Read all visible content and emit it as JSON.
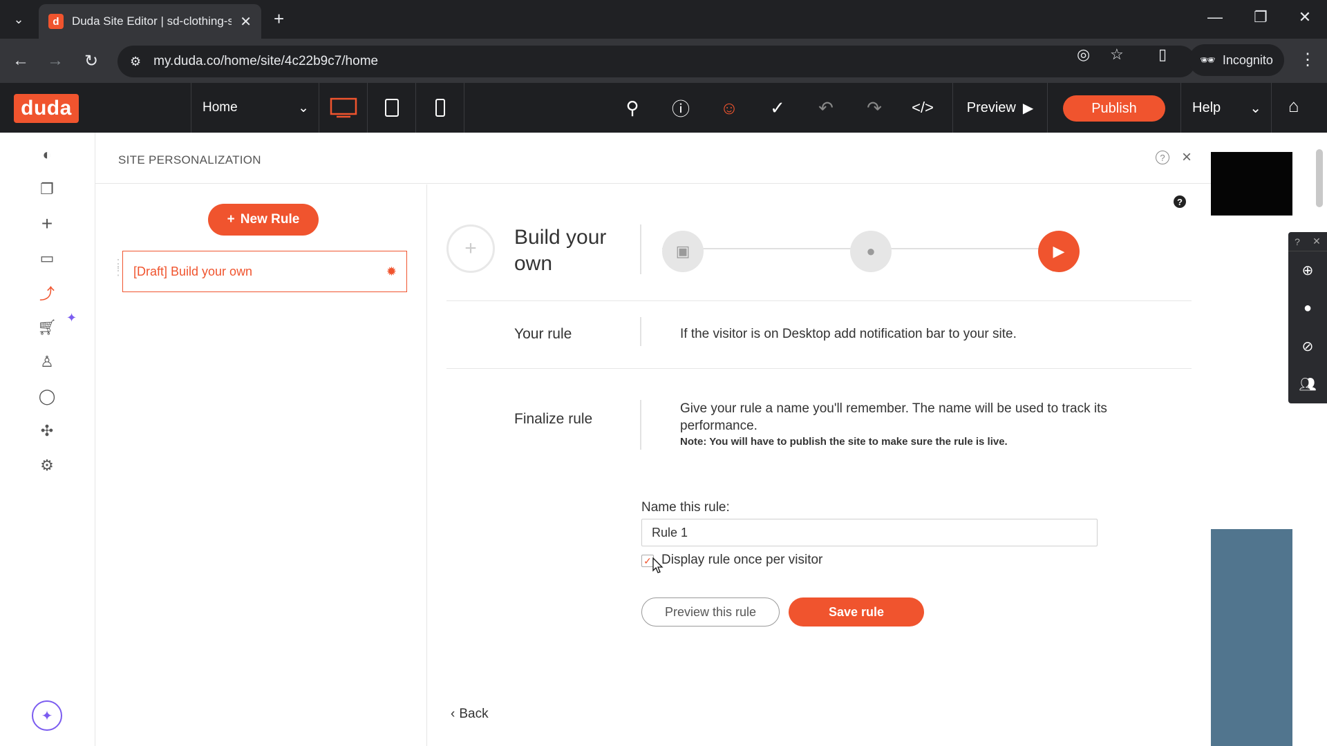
{
  "browser": {
    "tab_title": "Duda Site Editor | sd-clothing-s",
    "tab_favicon": "d",
    "url": "my.duda.co/home/site/4c22b9c7/home",
    "incognito_label": "Incognito"
  },
  "editor": {
    "logo": "duda",
    "page_select": "Home",
    "preview_label": "Preview",
    "publish_label": "Publish",
    "help_label": "Help"
  },
  "sidebar": {
    "items": [
      "palette-icon",
      "pages-icon",
      "add-icon",
      "folder-icon",
      "personalization-icon",
      "cart-icon",
      "user-icon",
      "chat-icon",
      "puzzle-icon",
      "settings-icon"
    ]
  },
  "panel": {
    "title": "SITE PERSONALIZATION",
    "new_rule_label": "New Rule",
    "draft_rule": "[Draft] Build your own",
    "rule_type_title": "Build your own",
    "your_rule_label": "Your rule",
    "your_rule_text": "If the visitor is on Desktop add notification bar to your site.",
    "finalize_label": "Finalize rule",
    "finalize_text": "Give your rule a name you'll remember. The name will be used to track its performance.",
    "finalize_note": "Note: You will have to publish the site to make sure the rule is live.",
    "name_label": "Name this rule:",
    "name_value": "Rule 1",
    "checkbox_label": "Display rule once per visitor",
    "checkbox_checked": true,
    "preview_rule_label": "Preview this rule",
    "save_rule_label": "Save rule",
    "back_label": "Back"
  },
  "colors": {
    "accent": "#f0542e",
    "topbar": "#1e1f22",
    "chrome": "#202124"
  }
}
